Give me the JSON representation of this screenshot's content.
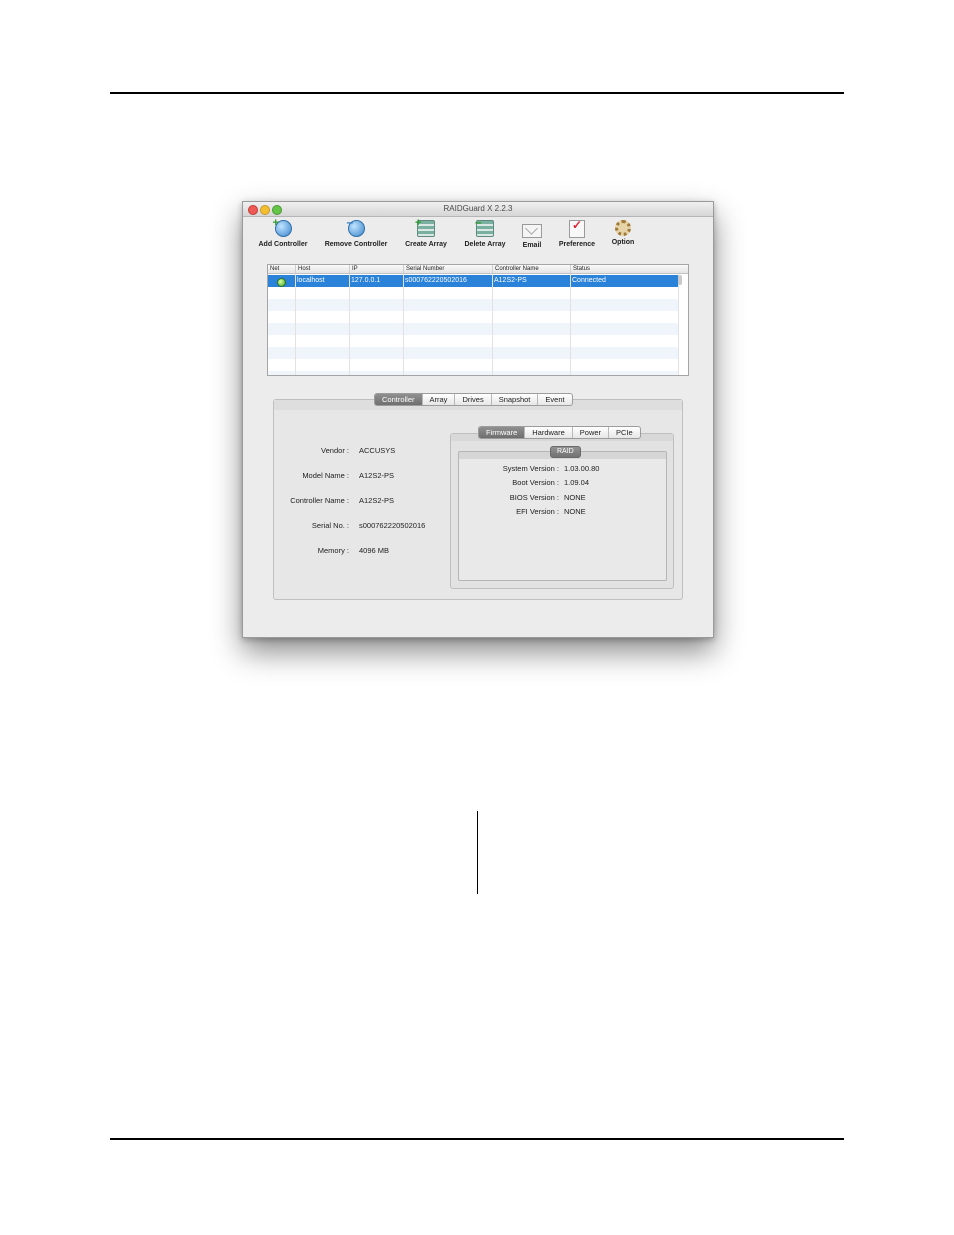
{
  "window": {
    "title": "RAIDGuard X 2.2.3"
  },
  "toolbar": [
    {
      "id": "add-controller",
      "label": "Add Controller",
      "icon": "globe-plus-icon"
    },
    {
      "id": "remove-controller",
      "label": "Remove Controller",
      "icon": "globe-minus-icon"
    },
    {
      "id": "create-array",
      "label": "Create Array",
      "icon": "disk-stack-plus-icon"
    },
    {
      "id": "delete-array",
      "label": "Delete Array",
      "icon": "disk-stack-minus-icon"
    },
    {
      "id": "email",
      "label": "Email",
      "icon": "envelope-icon"
    },
    {
      "id": "preference",
      "label": "Preference",
      "icon": "checkmark-clipboard-icon"
    },
    {
      "id": "option",
      "label": "Option",
      "icon": "gear-icon"
    }
  ],
  "controller_table": {
    "columns": [
      "Net",
      "Host",
      "IP",
      "Serial Number",
      "Controller Name",
      "Status"
    ],
    "rows": [
      {
        "net": "online",
        "host": "localhost",
        "ip": "127.0.0.1",
        "serial": "s000762220502016",
        "controller_name": "A12S2-PS",
        "status": "Connected",
        "selected": true
      }
    ]
  },
  "main_tabs": [
    {
      "label": "Controller",
      "active": true
    },
    {
      "label": "Array",
      "active": false
    },
    {
      "label": "Drives",
      "active": false
    },
    {
      "label": "Snapshot",
      "active": false
    },
    {
      "label": "Event",
      "active": false
    }
  ],
  "controller_info": {
    "vendor_label": "Vendor :",
    "vendor": "ACCUSYS",
    "model_label": "Model Name :",
    "model": "A12S2-PS",
    "controller_name_label": "Controller Name :",
    "controller_name": "A12S2-PS",
    "serial_label": "Serial No. :",
    "serial": "s000762220502016",
    "memory_label": "Memory :",
    "memory": "4096 MB"
  },
  "sub_tabs": [
    {
      "label": "Firmware",
      "active": true
    },
    {
      "label": "Hardware",
      "active": false
    },
    {
      "label": "Power",
      "active": false
    },
    {
      "label": "PCIe",
      "active": false
    }
  ],
  "firmware": {
    "section": "RAID",
    "system_label": "System Version :",
    "system": "1.03.00.80",
    "boot_label": "Boot Version :",
    "boot": "1.09.04",
    "bios_label": "BIOS Version :",
    "bios": "NONE",
    "efi_label": "EFI Version :",
    "efi": "NONE"
  },
  "colors": {
    "selection": "#2a82d9",
    "active_tab": "#7a7a7a"
  }
}
